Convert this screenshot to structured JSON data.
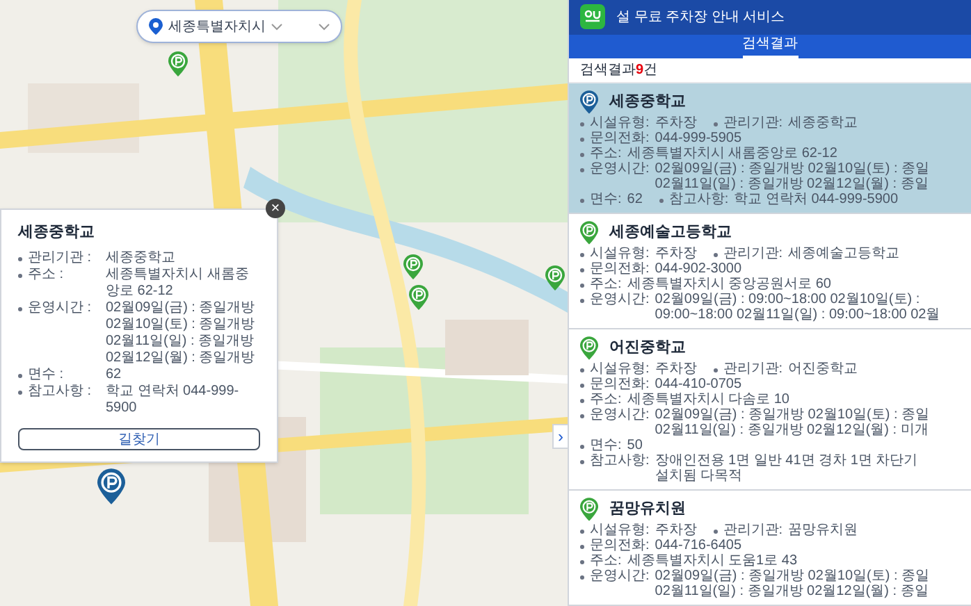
{
  "location_select": {
    "value": "세종특별자치시"
  },
  "map": {
    "kind": "picture",
    "pins": [
      {
        "selected": false
      },
      {
        "selected": true
      },
      {
        "selected": false
      },
      {
        "selected": false
      },
      {
        "selected": false
      }
    ]
  },
  "popup": {
    "title": "세종중학교",
    "fields": [
      {
        "label": "관리기관 :",
        "lines": [
          "세종중학교"
        ]
      },
      {
        "label": "주소 :",
        "lines": [
          "세종특별자치시 새롬중앙로 62-12"
        ]
      },
      {
        "label": "운영시간 :",
        "lines": [
          "02월09일(금) : 종일개방",
          "02월10일(토) : 종일개방",
          "02월11일(일) : 종일개방",
          "02월12일(월) : 종일개방"
        ]
      },
      {
        "label": "면수 :",
        "lines": [
          "62"
        ]
      },
      {
        "label": "참고사항 :",
        "lines": [
          "학교 연락처 044-999-5900"
        ]
      }
    ],
    "button": "길찾기",
    "close": "×"
  },
  "panel": {
    "title": "설 무료 주차장 안내 서비스",
    "tabs": [
      {
        "label": "검색결과",
        "selected": true
      }
    ],
    "result_label": "검색결과",
    "result_count": "9",
    "result_unit": "건",
    "collapse": "›",
    "results": [
      {
        "name": "세종중학교",
        "selected": true,
        "fields": [
          {
            "label": "시설유형:",
            "lines": [
              "주차장"
            ]
          },
          {
            "label": "관리기관:",
            "lines": [
              "세종중학교"
            ]
          },
          {
            "label": "문의전화:",
            "lines": [
              "044-999-5905"
            ]
          },
          {
            "label": "주소:",
            "lines": [
              "세종특별자치시 새롬중앙로 62-12"
            ]
          },
          {
            "label": "운영시간:",
            "lines": [
              "02월09일(금) : 종일개방 02월10일(토) : 종일",
              "02월11일(일) : 종일개방 02월12일(월) : 종일"
            ]
          },
          {
            "label": "면수:",
            "lines": [
              "62"
            ]
          },
          {
            "label": "참고사항:",
            "lines": [
              "학교 연락처 044-999-5900"
            ]
          }
        ]
      },
      {
        "name": "세종예술고등학교",
        "selected": false,
        "fields": [
          {
            "label": "시설유형:",
            "lines": [
              "주차장"
            ]
          },
          {
            "label": "관리기관:",
            "lines": [
              "세종예술고등학교"
            ]
          },
          {
            "label": "문의전화:",
            "lines": [
              "044-902-3000"
            ]
          },
          {
            "label": "주소:",
            "lines": [
              "세종특별자치시 중앙공원서로 60"
            ]
          },
          {
            "label": "운영시간:",
            "lines": [
              "02월09일(금) : 09:00~18:00 02월10일(토) :",
              "09:00~18:00 02월11일(일) : 09:00~18:00 02월"
            ]
          }
        ]
      },
      {
        "name": "어진중학교",
        "selected": false,
        "fields": [
          {
            "label": "시설유형:",
            "lines": [
              "주차장"
            ]
          },
          {
            "label": "관리기관:",
            "lines": [
              "어진중학교"
            ]
          },
          {
            "label": "문의전화:",
            "lines": [
              "044-410-0705"
            ]
          },
          {
            "label": "주소:",
            "lines": [
              "세종특별자치시 다솜로 10"
            ]
          },
          {
            "label": "운영시간:",
            "lines": [
              "02월09일(금) : 종일개방 02월10일(토) : 종일",
              "02월11일(일) : 종일개방 02월12일(월) : 미개"
            ]
          },
          {
            "label": "면수:",
            "lines": [
              "50"
            ]
          },
          {
            "label": "참고사항:",
            "lines": [
              "장애인전용 1면 일반 41면 경차 1면 차단기",
              "설치됨 다목적"
            ]
          }
        ]
      },
      {
        "name": "꿈망유치원",
        "selected": false,
        "fields": [
          {
            "label": "시설유형:",
            "lines": [
              "주차장"
            ]
          },
          {
            "label": "관리기관:",
            "lines": [
              "꿈망유치원"
            ]
          },
          {
            "label": "문의전화:",
            "lines": [
              "044-716-6405"
            ]
          },
          {
            "label": "주소:",
            "lines": [
              "세종특별자치시 도움1로 43"
            ]
          },
          {
            "label": "운영시간:",
            "lines": [
              "02월09일(금) : 종일개방 02월10일(토) : 종일",
              "02월11일(일) : 종일개방 02월12일(월) : 종일"
            ]
          }
        ]
      }
    ]
  }
}
